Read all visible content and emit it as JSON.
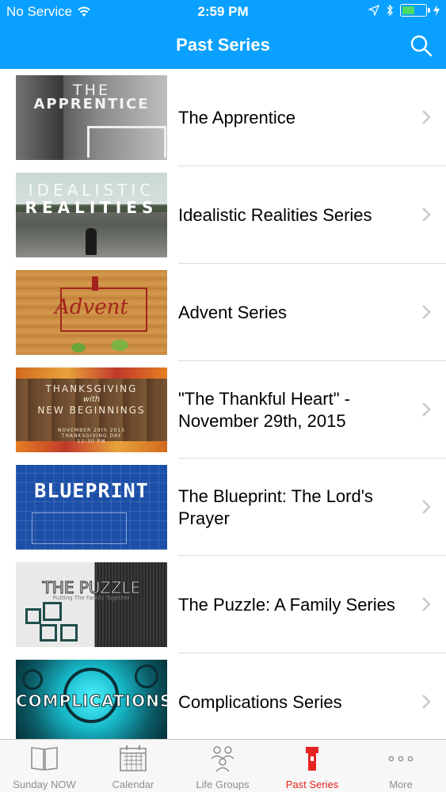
{
  "status_bar": {
    "carrier": "No Service",
    "time": "2:59 PM",
    "battery_color": "#4cd964",
    "battery_level_fraction": 0.55
  },
  "nav": {
    "title": "Past Series",
    "search_icon": "search-icon",
    "bar_color": "#0aa0ff"
  },
  "series": [
    {
      "label": "The Apprentice",
      "thumb_lines": [
        "THE",
        "APPRENTICE"
      ]
    },
    {
      "label": "Idealistic Realities Series",
      "thumb_lines": [
        "IDEALISTIC",
        "REALITIES"
      ]
    },
    {
      "label": "Advent Series",
      "thumb_lines": [
        "Advent"
      ]
    },
    {
      "label": "\"The Thankful Heart\" - November 29th, 2015",
      "thumb_lines": [
        "THANKSGIVING",
        "with",
        "NEW BEGINNINGS",
        "NOVEMBER 29th 2015",
        "THANKSGIVING DAY",
        "12:30 PM"
      ]
    },
    {
      "label": "The Blueprint: The Lord's Prayer",
      "thumb_lines": [
        "BLUEPRINT"
      ]
    },
    {
      "label": "The Puzzle: A Family Series",
      "thumb_lines": [
        "THE PUZZLE",
        "Putting The Family Together"
      ]
    },
    {
      "label": "Complications Series",
      "thumb_lines": [
        "COMPLICATIONS"
      ]
    }
  ],
  "tabs": [
    {
      "label": "Sunday NOW",
      "icon": "book-icon",
      "active": false
    },
    {
      "label": "Calendar",
      "icon": "calendar-icon",
      "active": false
    },
    {
      "label": "Life Groups",
      "icon": "people-icon",
      "active": false
    },
    {
      "label": "Past Series",
      "icon": "tower-icon",
      "active": true
    },
    {
      "label": "More",
      "icon": "more-icon",
      "active": false
    }
  ],
  "colors": {
    "active_tab": "#e6231f",
    "inactive_tab": "#8e8e93"
  }
}
